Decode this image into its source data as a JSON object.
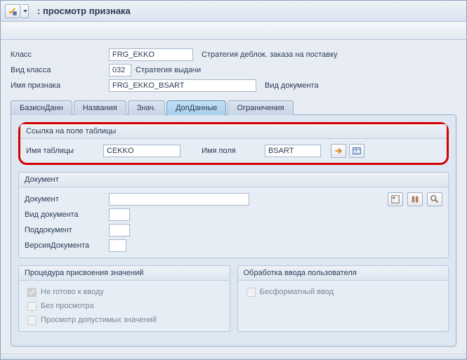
{
  "title": ": просмотр признака",
  "form": {
    "class_label": "Класс",
    "class_value": "FRG_EKKO",
    "class_desc": "Стратегия деблок. заказа на поставку",
    "classtype_label": "Вид класса",
    "classtype_value": "032",
    "classtype_desc": "Стратегия выдачи",
    "char_label": "Имя признака",
    "char_value": "FRG_EKKO_BSART",
    "char_desc": "Вид документа"
  },
  "tabs": {
    "t1": "БазиснДанн",
    "t2": "Названия",
    "t3": "Знач.",
    "t4": "ДопДанные",
    "t5": "Ограничения"
  },
  "ref": {
    "title": "Ссылка на поле таблицы",
    "table_label": "Имя таблицы",
    "table_value": "CEKKO",
    "field_label": "Имя поля",
    "field_value": "BSART"
  },
  "doc": {
    "title": "Документ",
    "doc_label": "Документ",
    "doctype_label": "Вид документа",
    "docpart_label": "Поддокумент",
    "docver_label": "ВерсияДокумента"
  },
  "proc": {
    "title": "Процедура присвоения значений",
    "c1": "Не готово к вводу",
    "c2": "Без просмотра",
    "c3": "Просмотр допустимых значений"
  },
  "userentry": {
    "title": "Обработка ввода пользователя",
    "c1": "Бесформатный ввод"
  }
}
